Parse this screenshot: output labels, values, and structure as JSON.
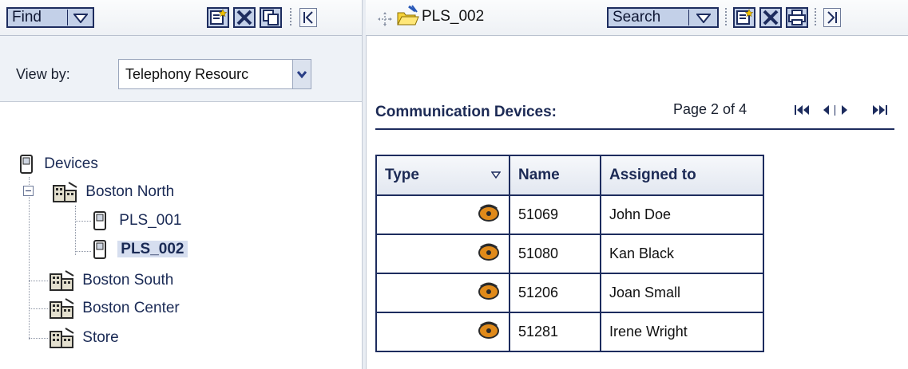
{
  "left_toolbar": {
    "find_label": "Find"
  },
  "right_toolbar": {
    "path_label": "PLS_002",
    "search_label": "Search"
  },
  "view_by": {
    "label": "View by:",
    "value": "Telephony Resourc"
  },
  "tree": {
    "root": "Devices",
    "nodes": [
      {
        "label": "Boston North",
        "expanded": true,
        "children": [
          "PLS_001",
          "PLS_002"
        ]
      },
      {
        "label": "Boston South"
      },
      {
        "label": "Boston Center"
      },
      {
        "label": "Store"
      }
    ],
    "selected": "PLS_002"
  },
  "content": {
    "section_title": "Communication Devices:",
    "pager": "Page 2 of 4",
    "columns": [
      "Type",
      "Name",
      "Assigned to"
    ],
    "rows": [
      {
        "name": "51069",
        "assigned": "John Doe"
      },
      {
        "name": "51080",
        "assigned": "Kan Black"
      },
      {
        "name": "51206",
        "assigned": "Joan Small"
      },
      {
        "name": "51281",
        "assigned": "Irene Wright"
      }
    ]
  },
  "icons": {
    "new": "new-document-icon",
    "delete": "delete-icon",
    "copy": "copy-icon",
    "print": "print-icon",
    "collapse_left": "collapse-left-icon",
    "collapse_right": "collapse-right-icon",
    "device": "device-icon",
    "site": "building-icon",
    "phone": "phone-icon",
    "folder": "open-folder-icon"
  },
  "colors": {
    "accent_border": "#1d2c5e",
    "button_fill": "#c3d0e8",
    "selection": "#d6deef"
  }
}
